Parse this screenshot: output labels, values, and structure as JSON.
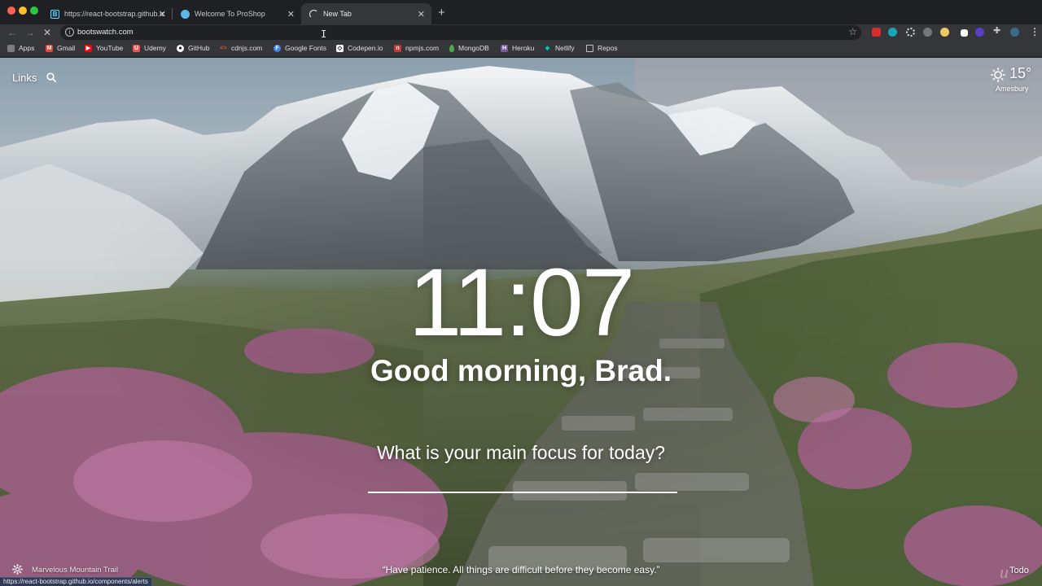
{
  "tabs": [
    {
      "title": "https://react-bootstrap.github.io",
      "icon": "react-bootstrap-favicon",
      "active": false
    },
    {
      "title": "Welcome To ProShop",
      "icon": "proshop-favicon",
      "active": false
    },
    {
      "title": "New Tab",
      "icon": "loading-spinner-icon",
      "active": true
    }
  ],
  "toolbar": {
    "url": "bootswatch.com"
  },
  "bookmarks": [
    {
      "label": "Apps",
      "icon": "apps-grid-icon",
      "color": "#bdc1c6"
    },
    {
      "label": "Gmail",
      "icon": "gmail-icon",
      "color": "#ea4335"
    },
    {
      "label": "YouTube",
      "icon": "youtube-icon",
      "color": "#ff0000"
    },
    {
      "label": "Udemy",
      "icon": "udemy-icon",
      "color": "#ec5252"
    },
    {
      "label": "GitHub",
      "icon": "github-icon",
      "color": "#ffffff"
    },
    {
      "label": "cdnjs.com",
      "icon": "cdnjs-icon",
      "color": "#d9643a"
    },
    {
      "label": "Google Fonts",
      "icon": "google-fonts-icon",
      "color": "#4285f4"
    },
    {
      "label": "Codepen.io",
      "icon": "codepen-icon",
      "color": "#ffffff"
    },
    {
      "label": "npmjs.com",
      "icon": "npm-icon",
      "color": "#cb3837"
    },
    {
      "label": "MongoDB",
      "icon": "mongodb-icon",
      "color": "#4fa94d"
    },
    {
      "label": "Heroku",
      "icon": "heroku-icon",
      "color": "#79589f"
    },
    {
      "label": "Netlify",
      "icon": "netlify-icon",
      "color": "#00c7b7"
    },
    {
      "label": "Repos",
      "icon": "folder-icon",
      "color": "#bdc1c6"
    }
  ],
  "momentum": {
    "links_label": "Links",
    "weather": {
      "temp": "15°",
      "location": "Amesbury"
    },
    "time": "11:07",
    "greeting": "Good morning, Brad.",
    "focus_question": "What is your main focus for today?",
    "focus_value": "",
    "photo_name": "Marvelous Mountain Trail",
    "quote": "“Have patience. All things are difficult before they become easy.”",
    "todo_label": "Todo"
  },
  "status_bar": {
    "hover_url": "https://react-bootstrap.github.io/components/alerts"
  },
  "colors": {
    "tabstrip": "#1f2023",
    "toolbar": "#35363a",
    "omnibox": "#202124",
    "status_bar": "#2e3a55"
  }
}
